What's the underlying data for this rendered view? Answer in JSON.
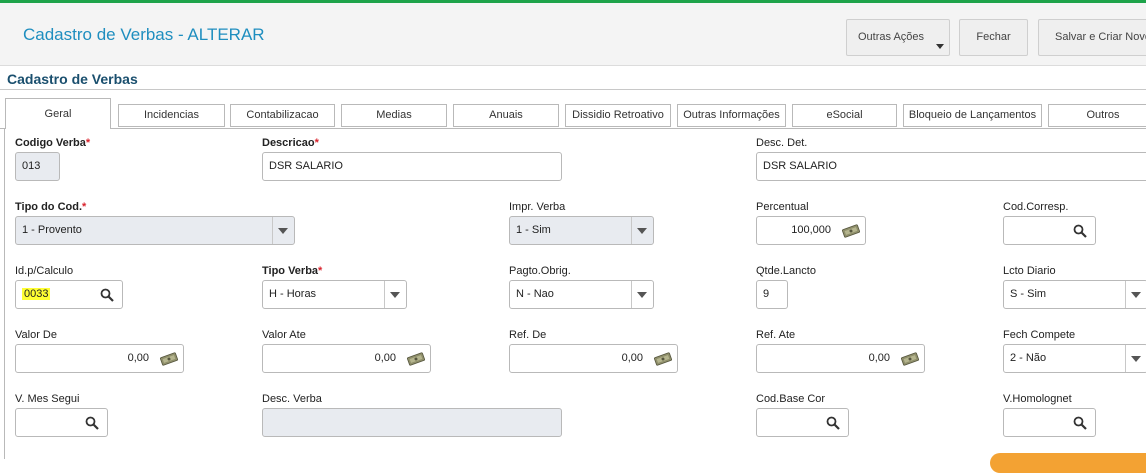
{
  "header": {
    "title": "Cadastro de Verbas - ALTERAR",
    "buttons": {
      "outras_acoes": "Outras Ações",
      "fechar": "Fechar",
      "salvar": "Salvar e Criar Novo"
    }
  },
  "section_title": "Cadastro de Verbas",
  "tabs": [
    {
      "label": "Geral",
      "active": true
    },
    {
      "label": "Incidencias"
    },
    {
      "label": "Contabilizacao"
    },
    {
      "label": "Medias"
    },
    {
      "label": "Anuais"
    },
    {
      "label": "Dissidio Retroativo"
    },
    {
      "label": "Outras Informações"
    },
    {
      "label": "eSocial"
    },
    {
      "label": "Bloqueio de Lançamentos"
    },
    {
      "label": "Outros"
    }
  ],
  "required_mark": "*",
  "fields": {
    "codigo_verba": {
      "label": "Codigo Verba",
      "value": "013"
    },
    "descricao": {
      "label": "Descricao",
      "value": "DSR SALARIO"
    },
    "desc_det": {
      "label": "Desc. Det.",
      "value": "DSR SALARIO"
    },
    "tipo_cod": {
      "label": "Tipo do Cod.",
      "value": "1 - Provento"
    },
    "impr_verba": {
      "label": "Impr. Verba",
      "value": "1 - Sim"
    },
    "percentual": {
      "label": "Percentual",
      "value": "100,000"
    },
    "cod_corresp": {
      "label": "Cod.Corresp.",
      "value": ""
    },
    "id_calculo": {
      "label": "Id.p/Calculo",
      "value": "0033"
    },
    "tipo_verba": {
      "label": "Tipo Verba",
      "value": "H - Horas"
    },
    "pagto_obrig": {
      "label": "Pagto.Obrig.",
      "value": "N - Nao"
    },
    "qtde_lancto": {
      "label": "Qtde.Lancto",
      "value": "9"
    },
    "lcto_diario": {
      "label": "Lcto Diario",
      "value": "S - Sim"
    },
    "valor_de": {
      "label": "Valor De",
      "value": "0,00"
    },
    "valor_ate": {
      "label": "Valor Ate",
      "value": "0,00"
    },
    "ref_de": {
      "label": "Ref. De",
      "value": "0,00"
    },
    "ref_ate": {
      "label": "Ref. Ate",
      "value": "0,00"
    },
    "fech_compete": {
      "label": "Fech Compete",
      "value": "2 - Não"
    },
    "v_mes_segui": {
      "label": "V. Mes Segui",
      "value": ""
    },
    "desc_verba": {
      "label": "Desc. Verba",
      "value": ""
    },
    "cod_base_cor": {
      "label": "Cod.Base Cor",
      "value": ""
    },
    "v_homolognet": {
      "label": "V.Homolognet",
      "value": ""
    }
  },
  "colors": {
    "title": "#1f8ebf",
    "section_title": "#1a4f6e",
    "required": "#d9232d",
    "readonly_bg": "#e8ebf0",
    "highlight": "#ffff33",
    "top_line": "#1ea34a"
  },
  "icons": [
    "search-icon",
    "money-icon",
    "dropdown-arrow-icon"
  ]
}
